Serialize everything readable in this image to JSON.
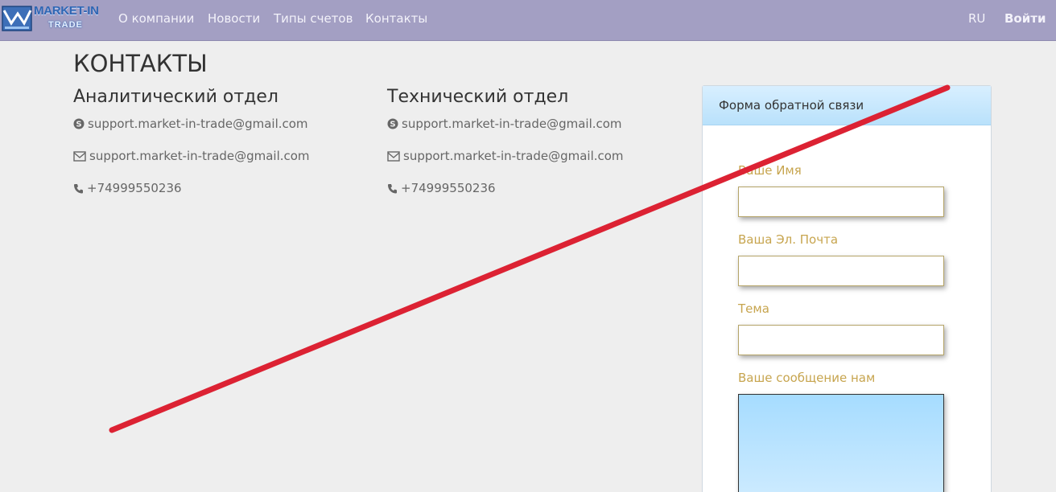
{
  "brand": {
    "name": "MARKET-IN",
    "sub": "TRADE"
  },
  "nav": {
    "items": [
      "О компании",
      "Новости",
      "Типы счетов",
      "Контакты"
    ],
    "lang": "RU",
    "login": "Войти"
  },
  "page": {
    "title": "КОНТАКТЫ"
  },
  "departments": [
    {
      "title": "Аналитический отдел",
      "skype": "support.market-in-trade@gmail.com",
      "email": "support.market-in-trade@gmail.com",
      "phone": "+74999550236"
    },
    {
      "title": "Технический отдел",
      "skype": "support.market-in-trade@gmail.com",
      "email": "support.market-in-trade@gmail.com",
      "phone": "+74999550236"
    }
  ],
  "form": {
    "heading": "Форма обратной связи",
    "name_label": "Ваше Имя",
    "email_label": "Ваша Эл. Почта",
    "subject_label": "Тема",
    "message_label": "Ваше сообщение нам"
  },
  "colors": {
    "navbar": "#a39fc3",
    "background": "#eeeeee",
    "form_label": "#c7a54f",
    "strike": "#dc2233"
  },
  "icons": [
    "logo-mark-icon",
    "skype-icon",
    "envelope-icon",
    "phone-icon"
  ]
}
